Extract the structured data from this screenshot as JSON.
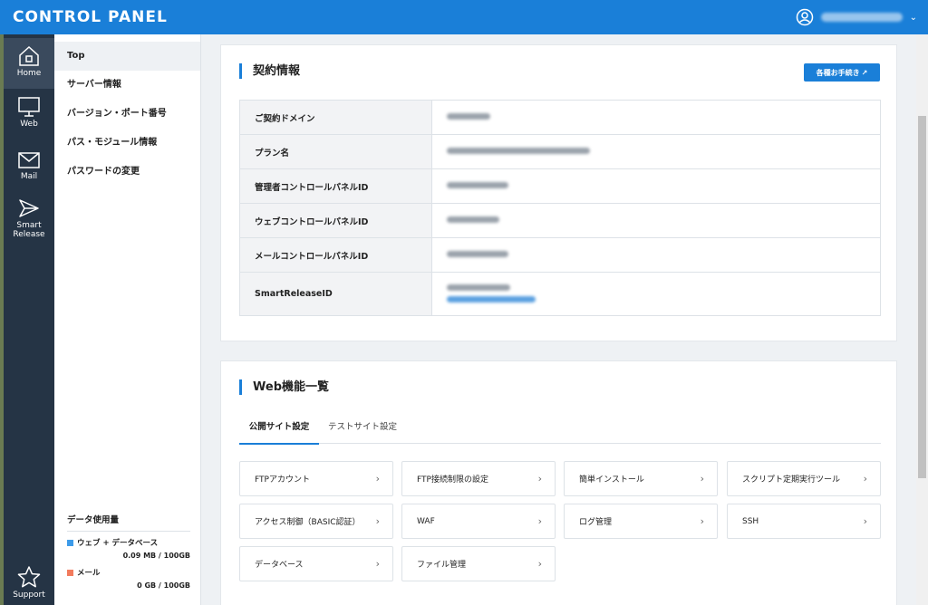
{
  "header": {
    "title": "CONTROL PANEL",
    "account_icon": "user-circle-icon",
    "dropdown_icon": "chevron-down-icon"
  },
  "rail": [
    {
      "label": "Home",
      "icon": "home-icon"
    },
    {
      "label": "Web",
      "icon": "monitor-icon"
    },
    {
      "label": "Mail",
      "icon": "mail-icon"
    },
    {
      "label": "Smart\nRelease",
      "icon": "send-icon"
    },
    {
      "label": "Support",
      "icon": "star-icon"
    }
  ],
  "submenu": {
    "items": [
      "Top",
      "サーバー情報",
      "バージョン・ポート番号",
      "パス・モジュール情報",
      "パスワードの変更"
    ],
    "usage_title": "データ使用量",
    "usage": [
      {
        "label": "ウェブ + データベース",
        "value": "0.09 MB / 100GB",
        "color": "#3d9be9"
      },
      {
        "label": "メール",
        "value": "0 GB / 100GB",
        "color": "#f27b5d"
      }
    ]
  },
  "contract": {
    "title": "契約情報",
    "button": "各種お手続き",
    "rows": [
      {
        "key": "ご契約ドメイン"
      },
      {
        "key": "プラン名"
      },
      {
        "key": "管理者コントロールパネルID"
      },
      {
        "key": "ウェブコントロールパネルID"
      },
      {
        "key": "メールコントロールパネルID"
      },
      {
        "key": "SmartReleaseID"
      }
    ]
  },
  "web": {
    "title": "Web機能一覧",
    "tabs": [
      "公開サイト設定",
      "テストサイト設定"
    ],
    "features": [
      "FTPアカウント",
      "FTP接続制限の設定",
      "簡単インストール",
      "スクリプト定期実行ツール",
      "アクセス制御（BASIC認証）",
      "WAF",
      "ログ管理",
      "SSH",
      "データベース",
      "ファイル管理"
    ]
  },
  "colors": {
    "accent": "#1a7fd8",
    "rail": "#253445"
  }
}
